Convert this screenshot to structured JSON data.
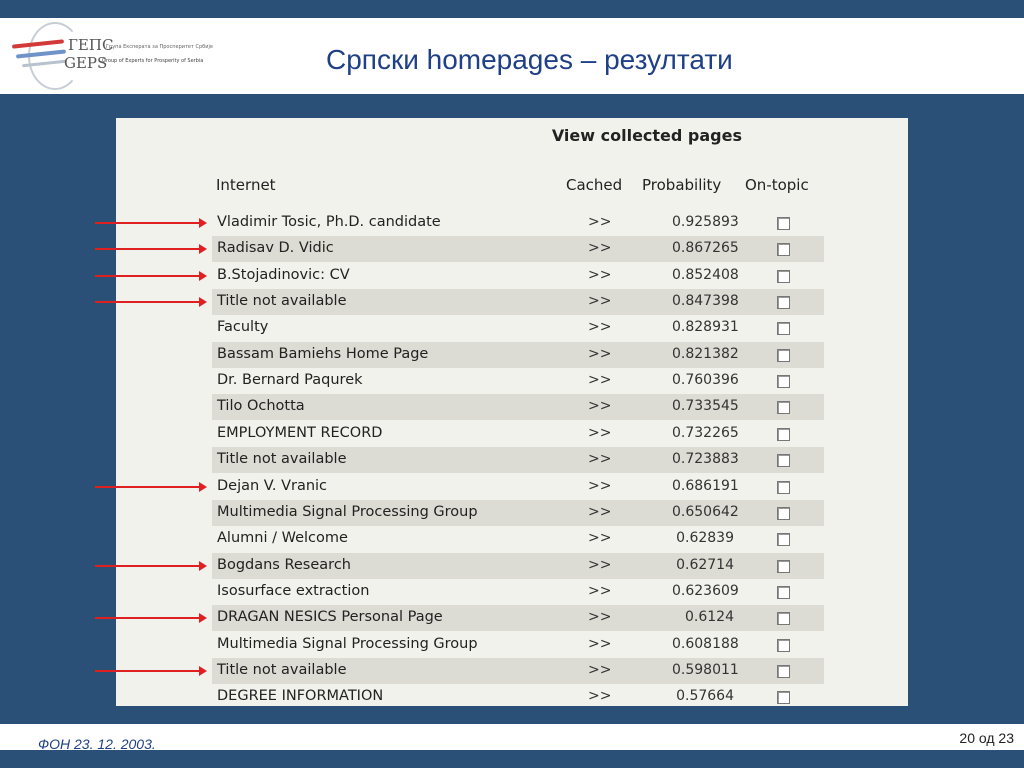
{
  "slide": {
    "title": "Српски homepages – резултати",
    "logo": {
      "name_cyr": "ГЕПС",
      "name_lat": "GEPS",
      "tagline_cyr": "Група Експерата за Просперитет Србије",
      "tagline_en": "Group of Experts for Prosperity of Serbia"
    },
    "footer_left": "ФОН  23. 12. 2003.",
    "footer_right": "20 од 23"
  },
  "table": {
    "heading": "View collected pages",
    "columns": {
      "name": "Internet",
      "cached": "Cached",
      "prob": "Probability",
      "ontopic": "On-topic"
    },
    "rows": [
      {
        "name": "Vladimir Tosic, Ph.D. candidate",
        "cached": ">>",
        "prob": "0.925893",
        "arrow": true
      },
      {
        "name": "Radisav D. Vidic",
        "cached": ">>",
        "prob": "0.867265",
        "arrow": true
      },
      {
        "name": "B.Stojadinovic: CV",
        "cached": ">>",
        "prob": "0.852408",
        "arrow": true
      },
      {
        "name": "Title not available",
        "cached": ">>",
        "prob": "0.847398",
        "arrow": true
      },
      {
        "name": "Faculty",
        "cached": ">>",
        "prob": "0.828931",
        "arrow": false
      },
      {
        "name": "Bassam Bamiehs Home Page",
        "cached": ">>",
        "prob": "0.821382",
        "arrow": false
      },
      {
        "name": "Dr. Bernard Paqurek",
        "cached": ">>",
        "prob": "0.760396",
        "arrow": false
      },
      {
        "name": "Tilo Ochotta",
        "cached": ">>",
        "prob": "0.733545",
        "arrow": false
      },
      {
        "name": "EMPLOYMENT RECORD",
        "cached": ">>",
        "prob": "0.732265",
        "arrow": false
      },
      {
        "name": "Title not available",
        "cached": ">>",
        "prob": "0.723883",
        "arrow": false
      },
      {
        "name": "Dejan V. Vranic",
        "cached": ">>",
        "prob": "0.686191",
        "arrow": true
      },
      {
        "name": "Multimedia Signal Processing Group",
        "cached": ">>",
        "prob": "0.650642",
        "arrow": false
      },
      {
        "name": "Alumni / Welcome",
        "cached": ">>",
        "prob": "0.62839",
        "arrow": false
      },
      {
        "name": "Bogdans Research",
        "cached": ">>",
        "prob": "0.62714",
        "arrow": true
      },
      {
        "name": "Isosurface extraction",
        "cached": ">>",
        "prob": "0.623609",
        "arrow": false
      },
      {
        "name": "DRAGAN NESICS Personal Page",
        "cached": ">>",
        "prob": "0.6124",
        "arrow": true
      },
      {
        "name": "Multimedia Signal Processing Group",
        "cached": ">>",
        "prob": "0.608188",
        "arrow": false
      },
      {
        "name": "Title not available",
        "cached": ">>",
        "prob": "0.598011",
        "arrow": true
      },
      {
        "name": "DEGREE INFORMATION",
        "cached": ">>",
        "prob": "0.57664",
        "arrow": false
      }
    ]
  },
  "colors": {
    "background": "#2b5077",
    "title": "#1f3f86",
    "arrow": "#e02020",
    "row_alt": "#dcdcd4",
    "panel": "#f2f2ec"
  }
}
